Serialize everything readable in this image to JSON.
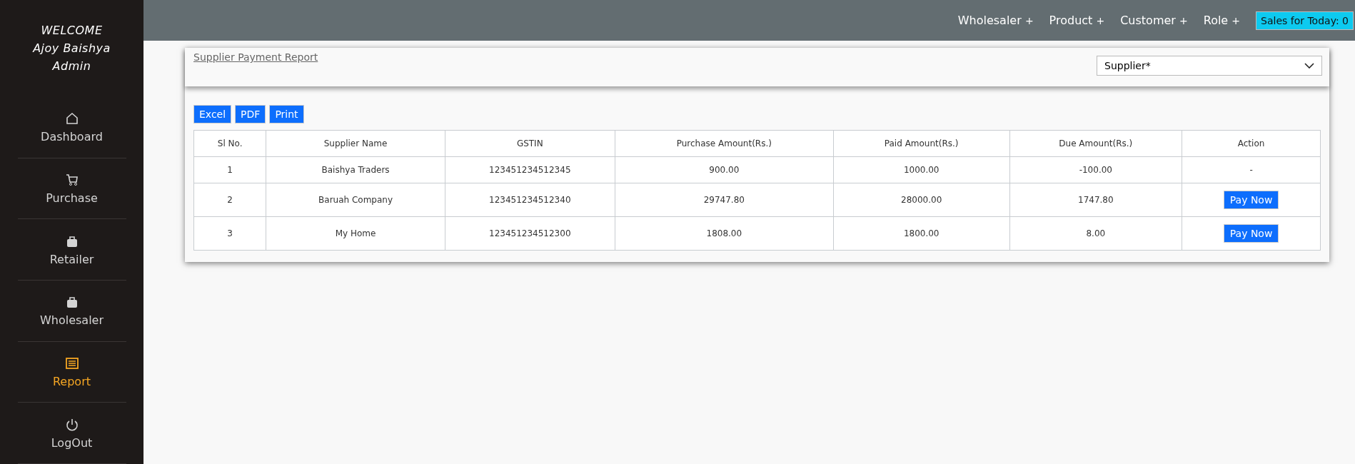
{
  "sidebar": {
    "welcome": "WELCOME",
    "user": "Ajoy Baishya",
    "role": "Admin",
    "items": [
      {
        "label": "Dashboard",
        "selected": false
      },
      {
        "label": "Purchase",
        "selected": false
      },
      {
        "label": "Retailer",
        "selected": false
      },
      {
        "label": "Wholesaler",
        "selected": false
      },
      {
        "label": "Report",
        "selected": true
      },
      {
        "label": "LogOut",
        "selected": false
      }
    ]
  },
  "topbar": {
    "menus": [
      {
        "label": "Wholesaler",
        "plus": "+"
      },
      {
        "label": "Product",
        "plus": "+"
      },
      {
        "label": "Customer",
        "plus": "+"
      },
      {
        "label": "Role",
        "plus": "+"
      }
    ],
    "sales_badge": "Sales for Today: 0"
  },
  "report": {
    "title": "Supplier Payment Report",
    "supplier_select": {
      "placeholder": "Supplier*"
    },
    "export_buttons": [
      "Excel",
      "PDF",
      "Print"
    ],
    "table": {
      "columns": [
        "Sl No.",
        "Supplier Name",
        "GSTIN",
        "Purchase Amount(Rs.)",
        "Paid Amount(Rs.)",
        "Due Amount(Rs.)",
        "Action"
      ],
      "rows": [
        {
          "cells": [
            "1",
            "Baishya Traders",
            "123451234512345",
            "900.00",
            "1000.00",
            "-100.00"
          ],
          "action": {
            "kind": "text",
            "label": "-"
          }
        },
        {
          "cells": [
            "2",
            "Baruah Company",
            "123451234512340",
            "29747.80",
            "28000.00",
            "1747.80"
          ],
          "action": {
            "kind": "button",
            "label": "Pay Now"
          }
        },
        {
          "cells": [
            "3",
            "My Home",
            "123451234512300",
            "1808.00",
            "1800.00",
            "8.00"
          ],
          "action": {
            "kind": "button",
            "label": "Pay Now"
          }
        }
      ]
    }
  }
}
